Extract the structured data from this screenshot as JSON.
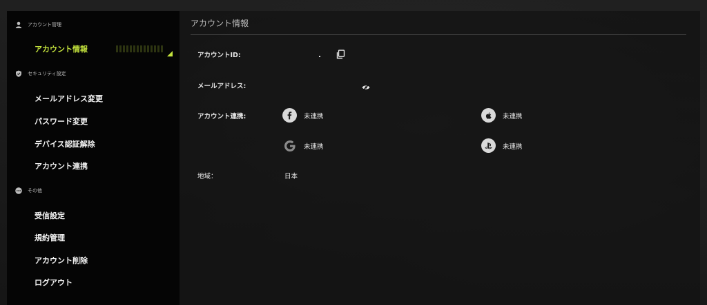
{
  "sidebar": {
    "sections": [
      {
        "heading": "アカウント管理",
        "icon": "user-icon",
        "items": [
          {
            "label": "アカウント情報",
            "active": true
          }
        ]
      },
      {
        "heading": "セキュリティ設定",
        "icon": "shield-icon",
        "items": [
          {
            "label": "メールアドレス変更"
          },
          {
            "label": "パスワード変更"
          },
          {
            "label": "デバイス認証解除"
          },
          {
            "label": "アカウント連携"
          }
        ]
      },
      {
        "heading": "その他",
        "icon": "more-icon",
        "items": [
          {
            "label": "受信設定"
          },
          {
            "label": "規約管理"
          },
          {
            "label": "アカウント削除"
          },
          {
            "label": "ログアウト"
          }
        ]
      }
    ]
  },
  "main": {
    "title": "アカウント情報",
    "account_id_label": "アカウントID:",
    "email_label": "メールアドレス:",
    "link_label": "アカウント連携:",
    "services": [
      {
        "name": "facebook",
        "icon": "facebook-icon",
        "status": "未連携"
      },
      {
        "name": "apple",
        "icon": "apple-icon",
        "status": "未連携"
      },
      {
        "name": "google",
        "icon": "google-icon",
        "status": "未連携"
      },
      {
        "name": "playstation",
        "icon": "playstation-icon",
        "status": "未連携"
      }
    ],
    "region_label": "地域：",
    "region_value": "日本"
  },
  "colors": {
    "accent": "#c4e33d",
    "sidebar_bg": "#050505",
    "icon_bg": "#d9d9d9"
  }
}
